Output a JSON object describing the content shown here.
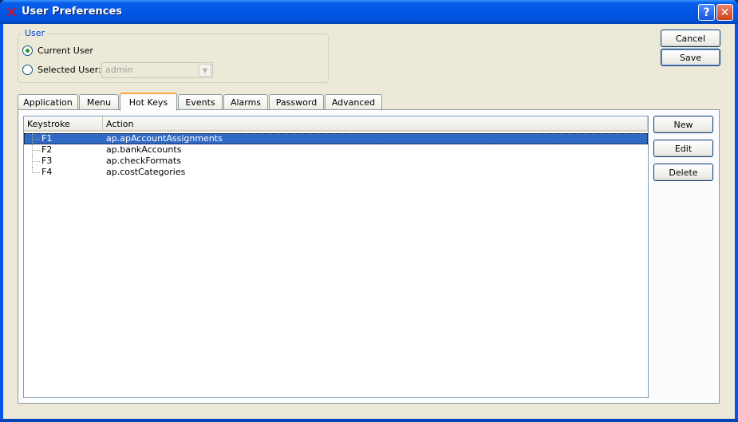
{
  "window": {
    "title": "User Preferences",
    "help_label": "?",
    "close_label": "✕"
  },
  "user_group": {
    "title": "User",
    "current_user_label": "Current User",
    "selected_user_label": "Selected User:",
    "selected_user_value": "admin",
    "selected_option": "current_user"
  },
  "actions": {
    "cancel": "Cancel",
    "save": "Save"
  },
  "tabs": [
    {
      "label": "Application"
    },
    {
      "label": "Menu"
    },
    {
      "label": "Hot Keys",
      "active": true
    },
    {
      "label": "Events"
    },
    {
      "label": "Alarms"
    },
    {
      "label": "Password"
    },
    {
      "label": "Advanced"
    }
  ],
  "hotkeys": {
    "columns": [
      "Keystroke",
      "Action"
    ],
    "rows": [
      {
        "key": "F1",
        "action": "ap.apAccountAssignments",
        "selected": true
      },
      {
        "key": "F2",
        "action": "ap.bankAccounts"
      },
      {
        "key": "F3",
        "action": "ap.checkFormats"
      },
      {
        "key": "F4",
        "action": "ap.costCategories"
      }
    ],
    "new_label": "New",
    "edit_label": "Edit",
    "delete_label": "Delete"
  },
  "colors": {
    "selection": "#316ac5",
    "active_tab_accent": "#f9a93a",
    "title_bar": "#0058e6"
  }
}
